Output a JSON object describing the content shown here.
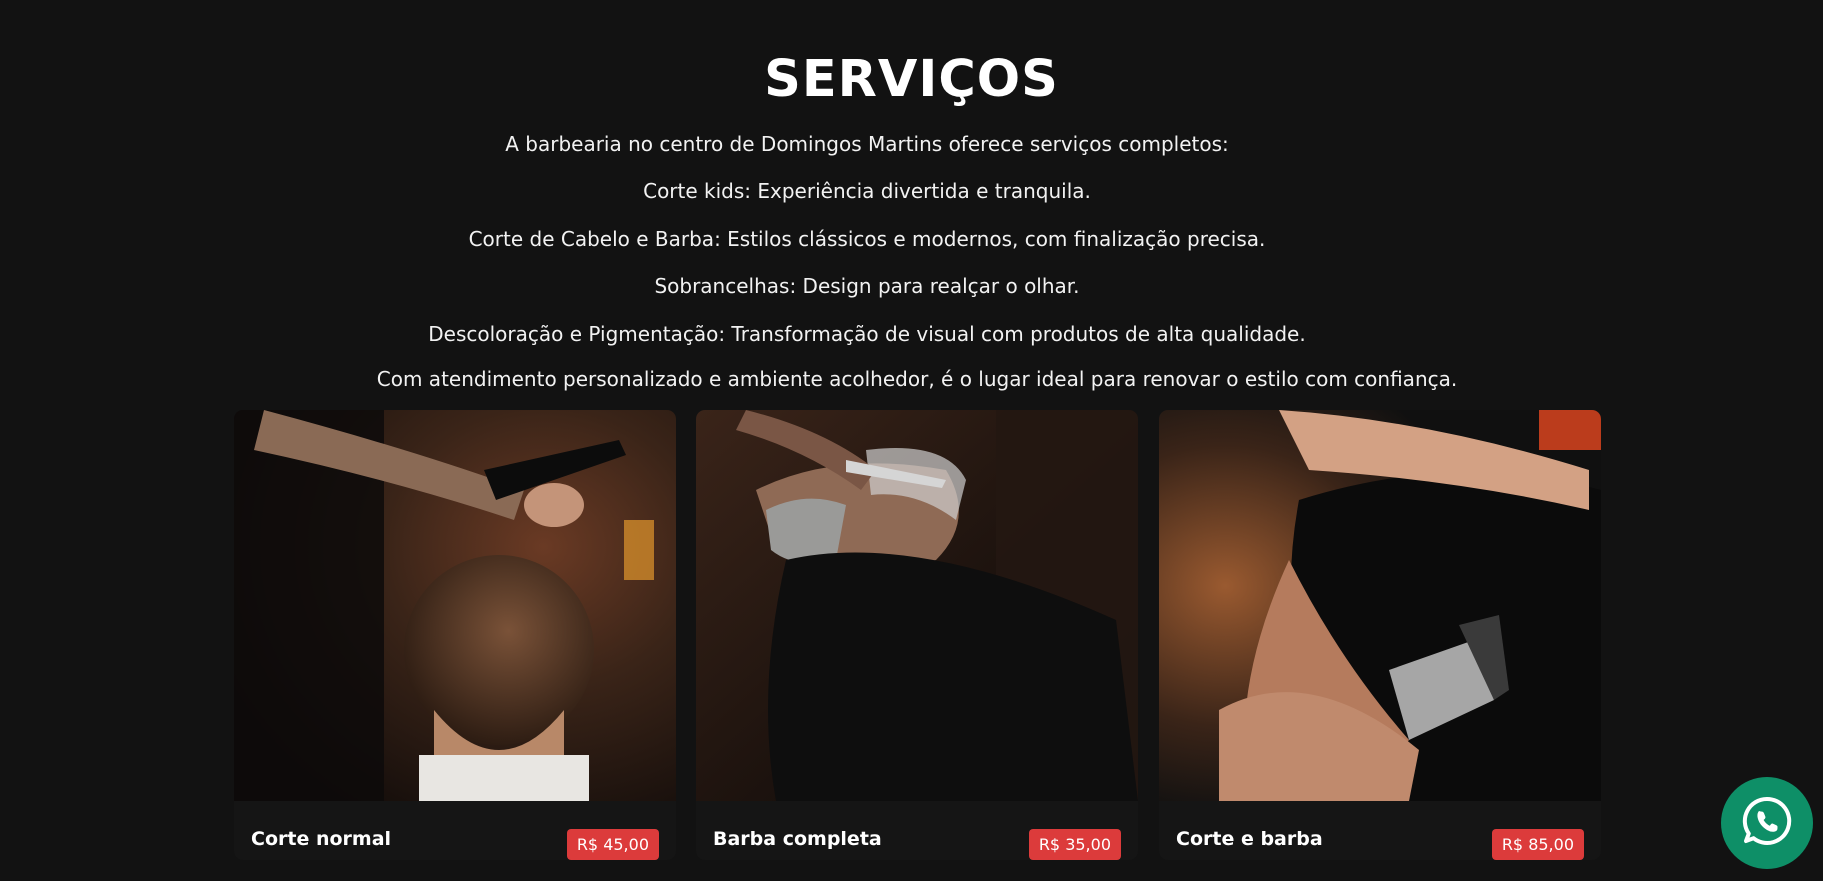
{
  "services": {
    "title": "SERVIÇOS",
    "description_lines": [
      "A barbearia no centro de Domingos Martins oferece serviços completos:",
      "Corte kids: Experiência divertida e tranquila.",
      "Corte de Cabelo e Barba: Estilos clássicos e modernos, com finalização precisa.",
      "Sobrancelhas: Design para realçar o olhar.",
      "Descoloração e Pigmentação: Transformação de visual com produtos de alta qualidade.",
      "Com atendimento personalizado e ambiente acolhedor, é o lugar ideal para renovar o estilo com confiança."
    ],
    "cards": [
      {
        "name": "Corte normal",
        "price": "R$ 45,00"
      },
      {
        "name": "Barba completa",
        "price": "R$ 35,00"
      },
      {
        "name": "Corte e barba",
        "price": "R$ 85,00"
      }
    ]
  },
  "whatsapp": {
    "icon": "whatsapp-icon"
  },
  "colors": {
    "background": "#121212",
    "price_badge": "#dc3b3b",
    "whatsapp": "#0e8f67"
  }
}
